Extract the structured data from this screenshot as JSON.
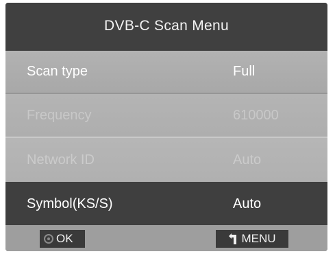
{
  "title": "DVB-C Scan Menu",
  "rows": [
    {
      "label": "Scan type",
      "value": "Full"
    },
    {
      "label": "Frequency",
      "value": "610000"
    },
    {
      "label": "Network ID",
      "value": "Auto"
    },
    {
      "label": "Symbol(KS/S)",
      "value": "Auto"
    }
  ],
  "footer": {
    "ok_label": "OK",
    "ok_icon": "circle-ok-icon",
    "menu_label": "MENU",
    "menu_icon": "return-arrow-icon"
  }
}
